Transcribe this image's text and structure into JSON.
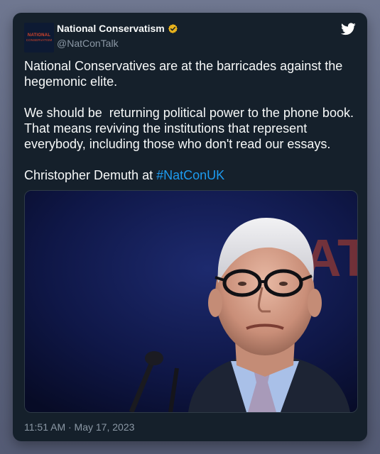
{
  "account": {
    "display_name": "National Conservatism",
    "handle": "@NatConTalk",
    "logo_line1": "NATIONAL",
    "logo_line2": "CONSERVATISM",
    "verified_color": "#e8b21c"
  },
  "tweet": {
    "paragraph1": "National Conservatives are at the barricades against the hegemonic elite.",
    "paragraph2": "We should be  returning political power to the phone book. That means reviving the institutions that represent everybody, including those who don't read our essays.",
    "paragraph3_prefix": "Christopher Demuth at ",
    "hashtag": "#NatConUK",
    "timestamp": "11:51 AM · May 17, 2023"
  },
  "media": {
    "background_lettering": "AT"
  },
  "icons": {
    "brand": "twitter-bird-icon",
    "verified": "verified-badge-icon"
  },
  "colors": {
    "card": "#15202b",
    "text": "#f7f9f9",
    "muted": "#8b98a5",
    "link": "#1d9bf0",
    "twitter_icon": "#ffffff"
  }
}
